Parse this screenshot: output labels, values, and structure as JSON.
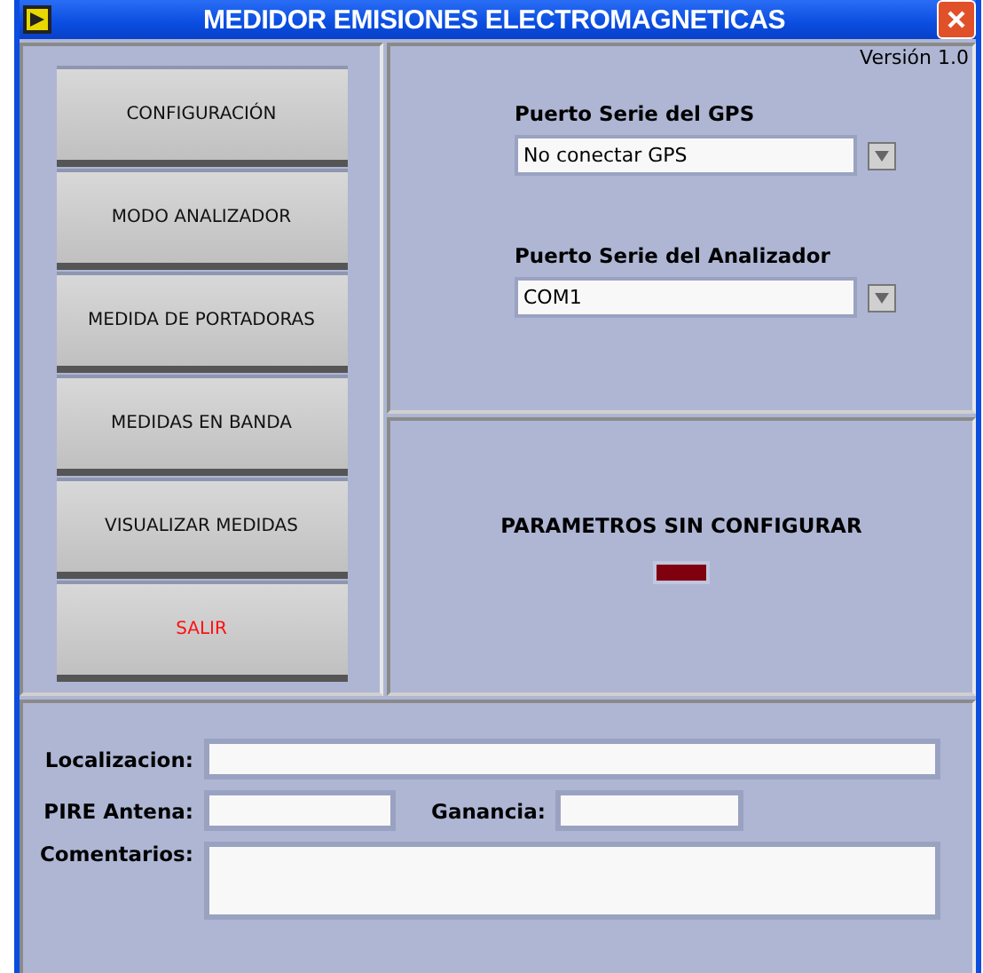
{
  "window": {
    "title": "MEDIDOR EMISIONES ELECTROMAGNETICAS"
  },
  "menu_buttons": [
    {
      "label": "CONFIGURACIÓN",
      "kind": "normal"
    },
    {
      "label": "MODO ANALIZADOR",
      "kind": "normal"
    },
    {
      "label": "MEDIDA DE PORTADORAS",
      "kind": "normal"
    },
    {
      "label": "MEDIDAS EN BANDA",
      "kind": "normal"
    },
    {
      "label": "VISUALIZAR MEDIDAS",
      "kind": "normal"
    },
    {
      "label": "SALIR",
      "kind": "exit"
    }
  ],
  "version": "Versión 1.0",
  "ports": [
    {
      "label": "Puerto Serie del GPS",
      "value": "No conectar GPS"
    },
    {
      "label": "Puerto Serie del Analizador",
      "value": "COM1"
    }
  ],
  "status": {
    "label": "PARAMETROS SIN CONFIGURAR",
    "on": false
  },
  "form": {
    "location_label": "Localizacion:",
    "eirp_label": "PIRE Antena:",
    "gain_label": "Ganancia:",
    "comments_label": "Comentarios:"
  }
}
